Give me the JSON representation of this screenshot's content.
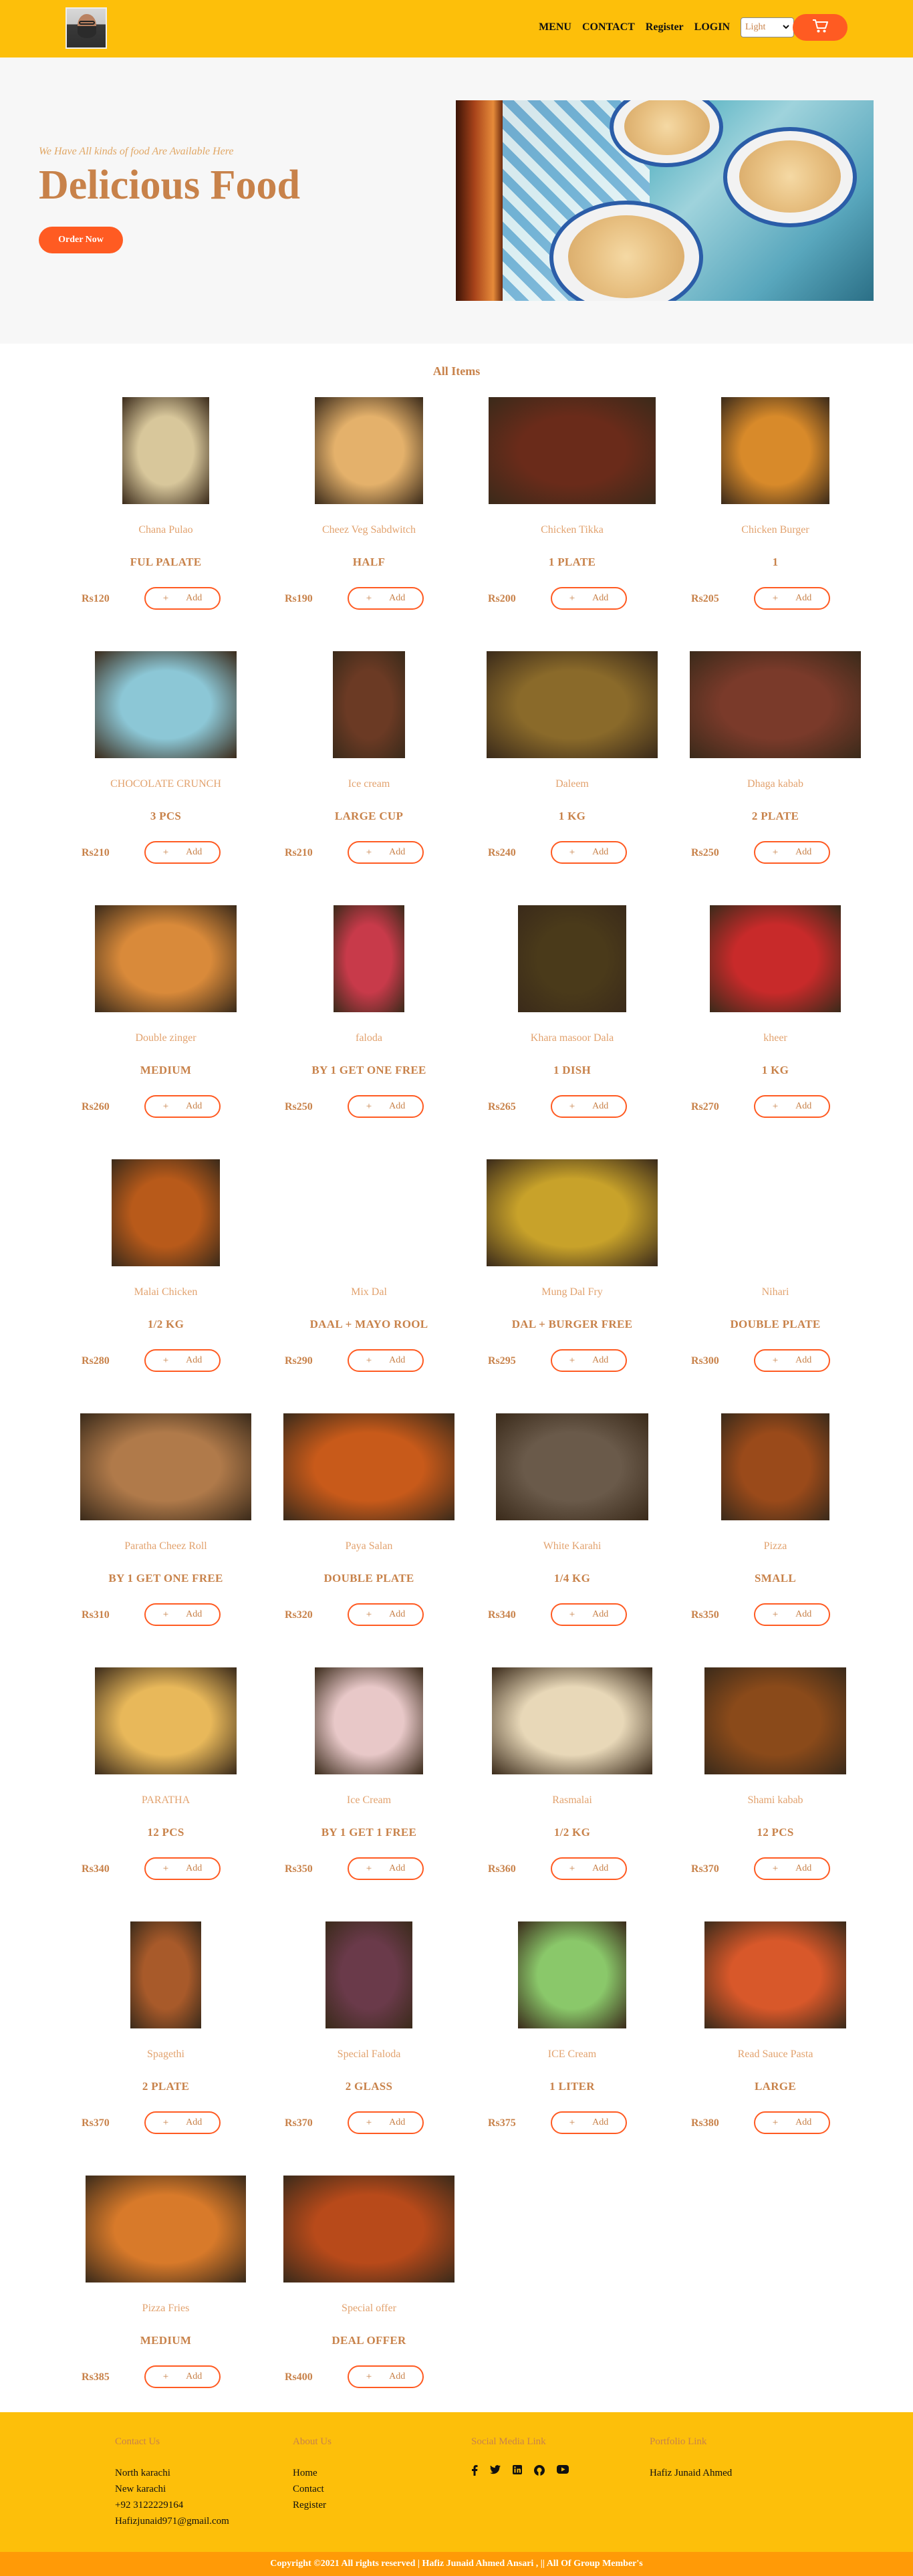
{
  "header": {
    "nav": [
      "MENU",
      "CONTACT",
      "Register",
      "LOGIN"
    ],
    "theme_select": "Light"
  },
  "hero": {
    "subtitle": "We Have All kinds of food Are Available Here",
    "title": "Delicious Food",
    "order_button": "Order Now"
  },
  "items_section": {
    "title": "All Items",
    "add_label": "Add",
    "add_plus": "+",
    "items": [
      {
        "name": "Chana Pulao",
        "desc": "FUL PALATE",
        "price": "Rs120",
        "color": "#d8c79b"
      },
      {
        "name": "Cheez Veg Sabdwitch",
        "desc": "HALF",
        "price": "Rs190",
        "color": "#e4b16b"
      },
      {
        "name": "Chicken Tikka",
        "desc": "1 PLATE",
        "price": "Rs200",
        "color": "#6a2b1a"
      },
      {
        "name": "Chicken Burger",
        "desc": "1",
        "price": "Rs205",
        "color": "#d88a2a"
      },
      {
        "name": "CHOCOLATE CRUNCH",
        "desc": "3 PCS",
        "price": "Rs210",
        "color": "#8cc7d6"
      },
      {
        "name": "Ice cream",
        "desc": "LARGE CUP",
        "price": "Rs210",
        "color": "#6b3a24"
      },
      {
        "name": "Daleem",
        "desc": "1 KG",
        "price": "Rs240",
        "color": "#8a6a2a"
      },
      {
        "name": "Dhaga kabab",
        "desc": "2 PLATE",
        "price": "Rs250",
        "color": "#7a3a2a"
      },
      {
        "name": "Double zinger",
        "desc": "MEDIUM",
        "price": "Rs260",
        "color": "#d98a3a"
      },
      {
        "name": "faloda",
        "desc": "BY 1 GET ONE FREE",
        "price": "Rs250",
        "color": "#c83a4a"
      },
      {
        "name": "Khara masoor Dala",
        "desc": "1 DISH",
        "price": "Rs265",
        "color": "#4a3a1a"
      },
      {
        "name": "kheer",
        "desc": "1 KG",
        "price": "Rs270",
        "color": "#c82a2a"
      },
      {
        "name": "Malai Chicken",
        "desc": "1/2 KG",
        "price": "Rs280",
        "color": "#b85a1a"
      },
      {
        "name": "Mix Dal",
        "desc": "DAAL + MAYO ROOL",
        "price": "Rs290",
        "color": ""
      },
      {
        "name": "Mung Dal Fry",
        "desc": "DAL + BURGER FREE",
        "price": "Rs295",
        "color": "#c8a22a"
      },
      {
        "name": "Nihari",
        "desc": "DOUBLE PLATE",
        "price": "Rs300",
        "color": ""
      },
      {
        "name": "Paratha Cheez Roll",
        "desc": "BY 1 GET ONE FREE",
        "price": "Rs310",
        "color": "#b07a4a"
      },
      {
        "name": "Paya Salan",
        "desc": "DOUBLE PLATE",
        "price": "Rs320",
        "color": "#c85a1a"
      },
      {
        "name": "White Karahi",
        "desc": "1/4 KG",
        "price": "Rs340",
        "color": "#6a5a4a"
      },
      {
        "name": "Pizza",
        "desc": "SMALL",
        "price": "Rs350",
        "color": "#9a4a1a"
      },
      {
        "name": "PARATHA",
        "desc": "12 PCS",
        "price": "Rs340",
        "color": "#e8b85a"
      },
      {
        "name": "Ice Cream",
        "desc": "BY 1 GET 1 FREE",
        "price": "Rs350",
        "color": "#e8c8c8"
      },
      {
        "name": "Rasmalai",
        "desc": "1/2 KG",
        "price": "Rs360",
        "color": "#e8d8b8"
      },
      {
        "name": "Shami kabab",
        "desc": "12 PCS",
        "price": "Rs370",
        "color": "#8a4a1a"
      },
      {
        "name": "Spagethi",
        "desc": "2 PLATE",
        "price": "Rs370",
        "color": "#a85a2a"
      },
      {
        "name": "Special Faloda",
        "desc": "2 GLASS",
        "price": "Rs370",
        "color": "#6a3a4a"
      },
      {
        "name": "ICE Cream",
        "desc": "1 LITER",
        "price": "Rs375",
        "color": "#8ac86a"
      },
      {
        "name": "Read Sauce Pasta",
        "desc": "LARGE",
        "price": "Rs380",
        "color": "#d8582a"
      },
      {
        "name": "Pizza Fries",
        "desc": "MEDIUM",
        "price": "Rs385",
        "color": "#d87a2a"
      },
      {
        "name": "Special offer",
        "desc": "DEAL OFFER",
        "price": "Rs400",
        "color": "#b84a1a"
      }
    ]
  },
  "footer": {
    "contact": {
      "title": "Contact Us",
      "lines": [
        "North karachi",
        "New karachi",
        "+92 3122229164",
        "Hafizjunaid971@gmail.com"
      ]
    },
    "about": {
      "title": "About Us",
      "links": [
        "Home",
        "Contact",
        "Register"
      ]
    },
    "social": {
      "title": "Social Media Link",
      "icons": [
        "facebook-icon",
        "twitter-icon",
        "linkedin-icon",
        "github-icon",
        "youtube-icon"
      ]
    },
    "portfolio": {
      "title": "Portfolio Link",
      "name": "Hafiz Junaid Ahmed"
    },
    "copyright": "Copyright ©2021 All rights reserved | Hafiz Junaid Ahmed Ansari , || All Of Group Member's"
  },
  "colors": {
    "header_bg": "#fdbf0a",
    "accent": "#ff5b22",
    "text_brown": "#c8824a",
    "copyright_bg": "#ff9a07"
  }
}
